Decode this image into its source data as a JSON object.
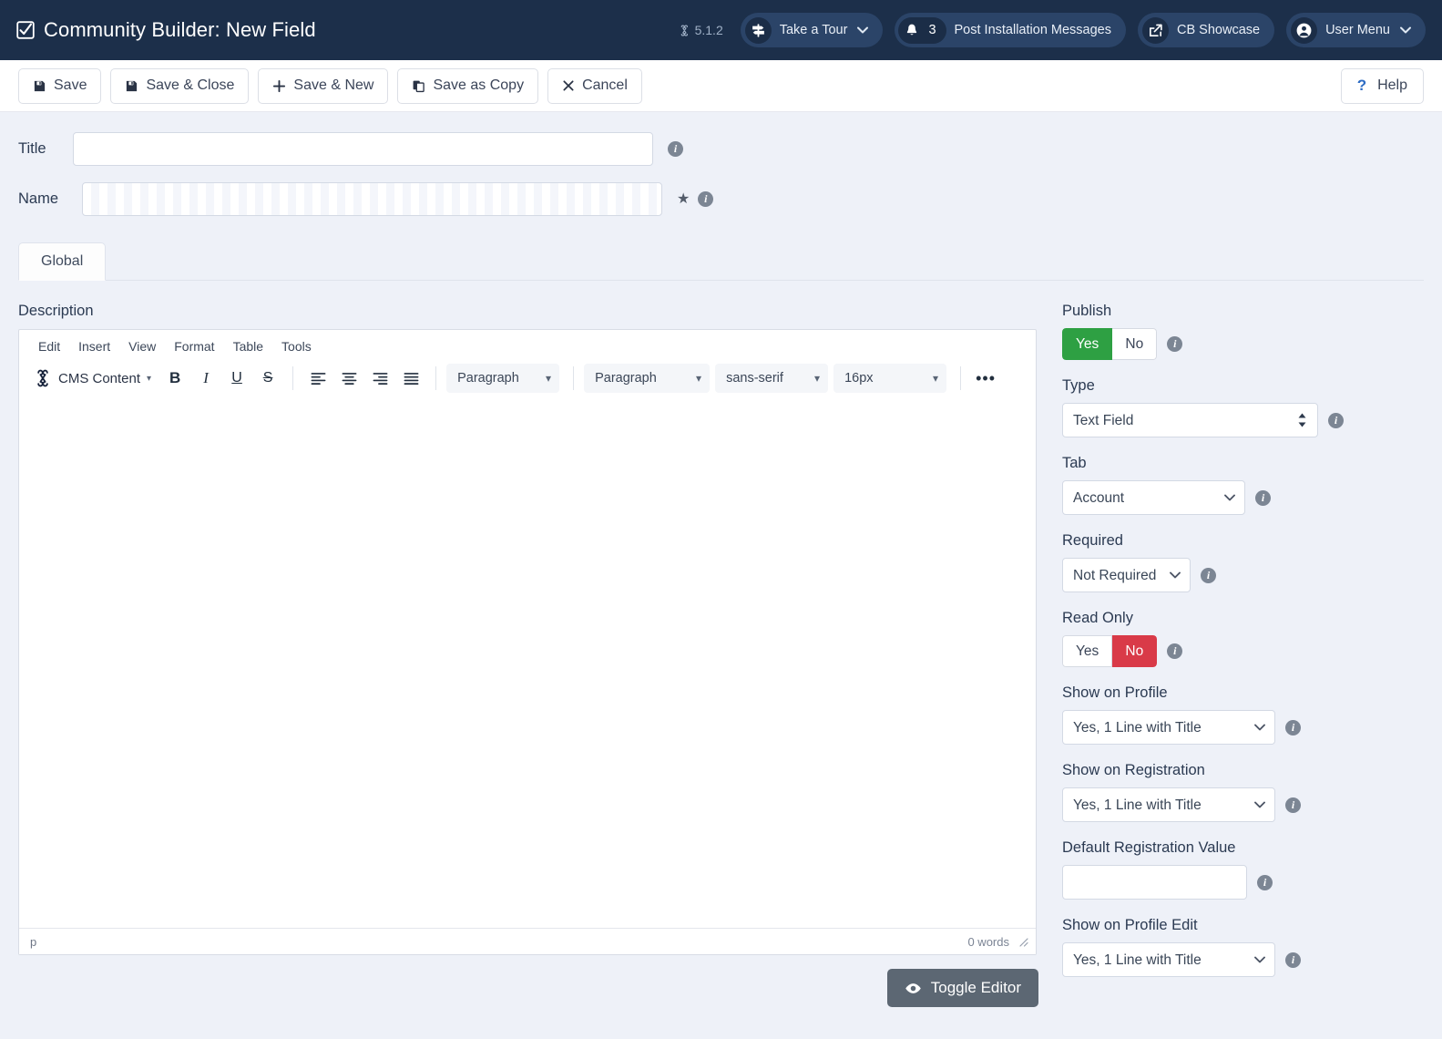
{
  "header": {
    "title": "Community Builder: New Field",
    "title_icon": "checkbox-checked-icon",
    "joomla_version": "5.1.2",
    "pills": [
      {
        "label": "Take a Tour",
        "icon": "signpost-icon",
        "caret": "⌄"
      },
      {
        "label": "Post Installation Messages",
        "icon": "bell-icon",
        "count": "3"
      },
      {
        "label": "CB Showcase",
        "icon": "external-link-icon"
      },
      {
        "label": "User Menu",
        "icon": "user-circle-icon",
        "caret": "⌄"
      }
    ]
  },
  "toolbar": {
    "buttons": [
      {
        "label": "Save",
        "icon": "floppy-disk-icon",
        "glyph": "💾"
      },
      {
        "label": "Save & Close",
        "icon": "floppy-disk-icon",
        "glyph": "💾"
      },
      {
        "label": "Save & New",
        "icon": "plus-icon",
        "glyph": "✚"
      },
      {
        "label": "Save as Copy",
        "icon": "copy-icon",
        "glyph": "❐"
      },
      {
        "label": "Cancel",
        "icon": "close-x-icon",
        "glyph": "✕"
      }
    ],
    "help": {
      "label": "Help",
      "icon": "question-mark-icon",
      "glyph": "?"
    }
  },
  "form": {
    "title_label": "Title",
    "title_value": "",
    "title_placeholder": "",
    "name_label": "Name",
    "name_value": "",
    "name_placeholder": "",
    "tabs": [
      {
        "label": "Global",
        "active": true
      }
    ]
  },
  "editor": {
    "section_label": "Description",
    "menus": [
      "Edit",
      "Insert",
      "View",
      "Format",
      "Table",
      "Tools"
    ],
    "cms_button": "CMS Content",
    "format_buttons": [
      {
        "name": "bold",
        "glyph": "B"
      },
      {
        "name": "italic",
        "glyph": "I"
      },
      {
        "name": "underline",
        "glyph": "U"
      },
      {
        "name": "strikethrough",
        "glyph": "S"
      }
    ],
    "align_buttons": [
      "align-left",
      "align-center",
      "align-right",
      "align-justify"
    ],
    "selects": [
      {
        "name": "blocks",
        "value": "Paragraph"
      },
      {
        "name": "blocks2",
        "value": "Paragraph"
      },
      {
        "name": "fontfamily",
        "value": "sans-serif"
      },
      {
        "name": "fontsize",
        "value": "16px"
      }
    ],
    "more_label": "•••",
    "content": "",
    "status_path": "p",
    "word_count": "0 words",
    "toggle_button": "Toggle Editor"
  },
  "side": {
    "publish": {
      "label": "Publish",
      "options": [
        "Yes",
        "No"
      ],
      "selected": "Yes",
      "selected_color": "#2ea043"
    },
    "type": {
      "label": "Type",
      "value": "Text Field"
    },
    "tab": {
      "label": "Tab",
      "value": "Account"
    },
    "required": {
      "label": "Required",
      "value": "Not Required"
    },
    "read_only": {
      "label": "Read Only",
      "options": [
        "Yes",
        "No"
      ],
      "selected": "No",
      "selected_color": "#d93a48"
    },
    "show_on_profile": {
      "label": "Show on Profile",
      "value": "Yes, 1 Line with Title"
    },
    "show_on_registration": {
      "label": "Show on Registration",
      "value": "Yes, 1 Line with Title"
    },
    "default_registration_value": {
      "label": "Default Registration Value",
      "value": "",
      "placeholder": ""
    },
    "show_on_profile_edit": {
      "label": "Show on Profile Edit",
      "value": "Yes, 1 Line with Title"
    }
  },
  "colors": {
    "header_bg": "#1c2f4a",
    "pill_bg": "#2b4468",
    "page_bg": "#eef1f8",
    "publish_green": "#2ea043",
    "readonly_red": "#d93a48",
    "toggle_gray": "#5c6773",
    "help_blue": "#2d6cc4"
  }
}
